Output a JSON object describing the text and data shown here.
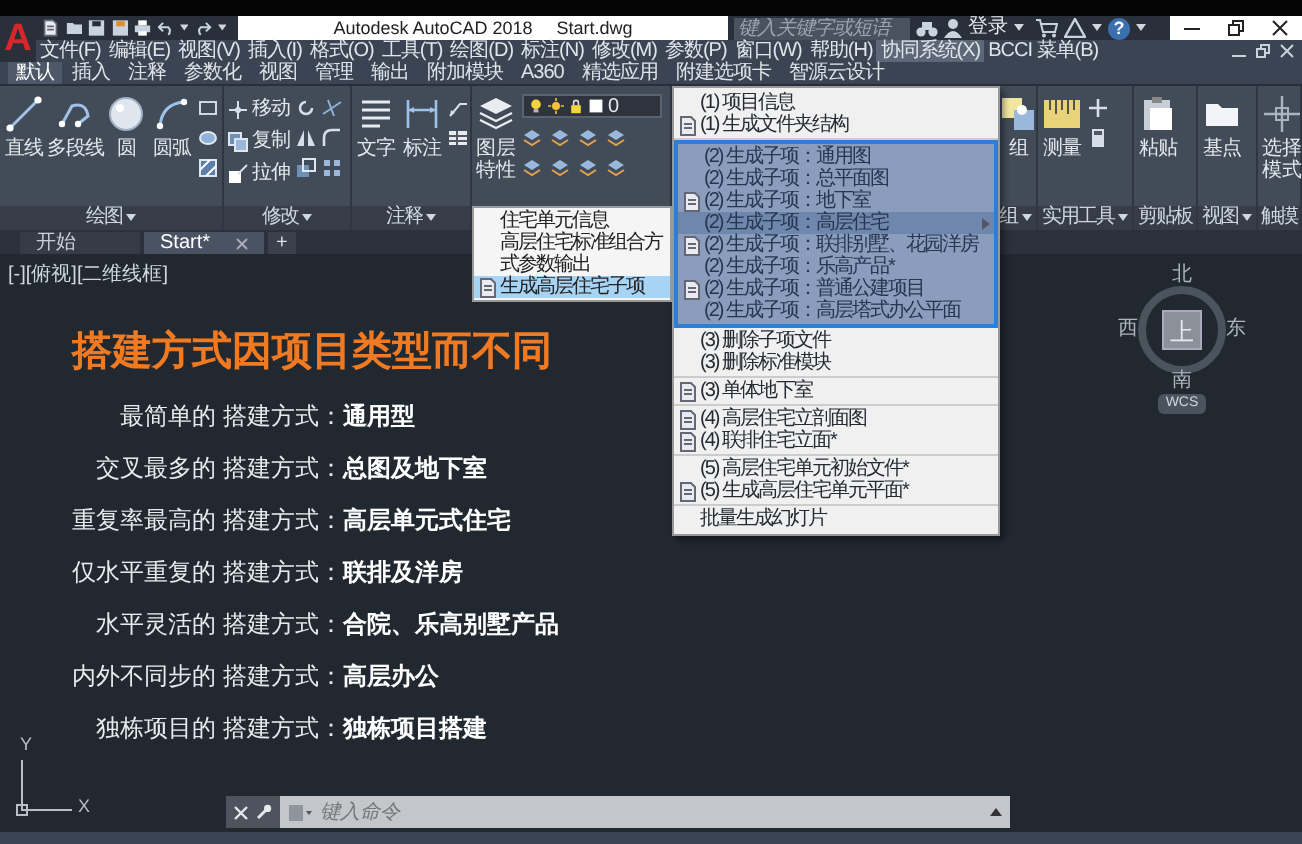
{
  "title_bar": {
    "logo": "A",
    "title": "Autodesk AutoCAD 2018",
    "file_name": "Start.dwg",
    "search": {
      "placeholder": "键入关键字或短语"
    },
    "sign_in": "登录",
    "help": "?"
  },
  "menu_bar": [
    {
      "label": "文件(F)",
      "selected": false
    },
    {
      "label": "编辑(E)",
      "selected": false
    },
    {
      "label": "视图(V)",
      "selected": false
    },
    {
      "label": "插入(I)",
      "selected": false
    },
    {
      "label": "格式(O)",
      "selected": false
    },
    {
      "label": "工具(T)",
      "selected": false
    },
    {
      "label": "绘图(D)",
      "selected": false
    },
    {
      "label": "标注(N)",
      "selected": false
    },
    {
      "label": "修改(M)",
      "selected": false
    },
    {
      "label": "参数(P)",
      "selected": false
    },
    {
      "label": "窗口(W)",
      "selected": false
    },
    {
      "label": "帮助(H)",
      "selected": false
    },
    {
      "label": "协同系统(X)",
      "selected": true
    },
    {
      "label": "BCCI 菜单(B)",
      "selected": false
    }
  ],
  "ribbon_tabs": [
    {
      "label": "默认",
      "selected": true
    },
    {
      "label": "插入",
      "selected": false
    },
    {
      "label": "注释",
      "selected": false
    },
    {
      "label": "参数化",
      "selected": false
    },
    {
      "label": "视图",
      "selected": false
    },
    {
      "label": "管理",
      "selected": false
    },
    {
      "label": "输出",
      "selected": false
    },
    {
      "label": "附加模块",
      "selected": false
    },
    {
      "label": "A360",
      "selected": false
    },
    {
      "label": "精选应用",
      "selected": false
    },
    {
      "label": "附建选项卡",
      "selected": false
    },
    {
      "label": "智源云设计",
      "selected": false
    }
  ],
  "ribbon_panels": [
    {
      "title": "绘图",
      "has_menu": true,
      "tools": [
        {
          "label": "直线",
          "kind": "large"
        },
        {
          "label": "多段线",
          "kind": "large"
        },
        {
          "label": "圆",
          "kind": "large"
        },
        {
          "label": "圆弧",
          "kind": "large"
        }
      ]
    },
    {
      "title": "修改",
      "has_menu": true,
      "tools": [
        {
          "label": "移动",
          "kind": "small"
        },
        {
          "label": "复制",
          "kind": "small"
        },
        {
          "label": "拉伸",
          "kind": "small"
        }
      ]
    },
    {
      "title": "注释",
      "has_menu": true,
      "tools": [
        {
          "label": "文字",
          "kind": "large"
        },
        {
          "label": "标注",
          "kind": "large"
        }
      ]
    },
    {
      "tools": [
        {
          "label": "图层特性",
          "kind": "large_wrapped"
        }
      ],
      "layer": "0"
    }
  ],
  "ribbon_panels_right": [
    {
      "title": "组",
      "has_menu": true,
      "tools": [
        {
          "label": "组",
          "kind": "large"
        }
      ]
    },
    {
      "title": "实用工具",
      "has_menu": true,
      "tools": [
        {
          "label": "测量",
          "kind": "large"
        }
      ]
    },
    {
      "title": "剪贴板",
      "has_menu": false,
      "tools": [
        {
          "label": "粘贴",
          "kind": "large"
        }
      ]
    },
    {
      "title": "视图",
      "has_menu": true,
      "tools": [
        {
          "label": "基点",
          "kind": "large"
        }
      ]
    },
    {
      "title": "触摸",
      "has_menu": false,
      "tools": [
        {
          "label": "选择模式",
          "kind": "large_wrapped"
        }
      ]
    }
  ],
  "file_tabs": [
    {
      "label": "开始",
      "selected": false
    },
    {
      "label": "Start*",
      "selected": true
    }
  ],
  "new_tab": "+",
  "viewport_label": "[-][俯视][二维线框]",
  "content": {
    "title": "搭建方式因项目类型而不同",
    "lines": [
      {
        "label": "最简单的 搭建方式：",
        "value": "通用型"
      },
      {
        "label": "交叉最多的 搭建方式：",
        "value": "总图及地下室"
      },
      {
        "label": "重复率最高的 搭建方式：",
        "value": "高层单元式住宅"
      },
      {
        "label": "仅水平重复的 搭建方式：",
        "value": "联排及洋房"
      },
      {
        "label": "水平灵活的 搭建方式：",
        "value": "合院、乐高别墅产品"
      },
      {
        "label": "内外不同步的 搭建方式：",
        "value": "高层办公"
      },
      {
        "label": "独栋项目的 搭建方式：",
        "value": "独栋项目搭建"
      }
    ]
  },
  "dropdown": {
    "sections": [
      {
        "framed": false,
        "items": [
          {
            "label": "(1) 项目信息",
            "has_icon": false,
            "has_submenu": false,
            "selected": false
          },
          {
            "label": "(1) 生成文件夹结构",
            "has_icon": true,
            "has_submenu": false,
            "selected": false
          }
        ]
      },
      {
        "framed": true,
        "items": [
          {
            "label": "(2) 生成子项：通用图",
            "has_icon": false,
            "has_submenu": false,
            "selected": false
          },
          {
            "label": "(2) 生成子项：总平面图",
            "has_icon": false,
            "has_submenu": false,
            "selected": false
          },
          {
            "label": "(2) 生成子项：地下室",
            "has_icon": true,
            "has_submenu": false,
            "selected": false
          },
          {
            "label": "(2) 生成子项：高层住宅",
            "has_icon": false,
            "has_submenu": true,
            "selected": true
          },
          {
            "label": "(2) 生成子项：联排别墅、花园洋房",
            "has_icon": true,
            "has_submenu": false,
            "selected": false
          },
          {
            "label": "(2) 生成子项：乐高产品*",
            "has_icon": false,
            "has_submenu": false,
            "selected": false
          },
          {
            "label": "(2) 生成子项：普通公建项目",
            "has_icon": true,
            "has_submenu": false,
            "selected": false
          },
          {
            "label": "(2) 生成子项：高层塔式办公平面",
            "has_icon": false,
            "has_submenu": false,
            "selected": false
          }
        ]
      },
      {
        "framed": false,
        "items": [
          {
            "label": "(3) 删除子项文件",
            "has_icon": false,
            "has_submenu": false,
            "selected": false
          },
          {
            "label": "(3) 删除标准模块",
            "has_icon": false,
            "has_submenu": false,
            "selected": false
          }
        ]
      },
      {
        "framed": false,
        "items": [
          {
            "label": "(3) 单体地下室",
            "has_icon": true,
            "has_submenu": false,
            "selected": false
          }
        ]
      },
      {
        "framed": false,
        "items": [
          {
            "label": "(4) 高层住宅立剖面图",
            "has_icon": true,
            "has_submenu": false,
            "selected": false
          },
          {
            "label": "(4) 联排住宅立面*",
            "has_icon": true,
            "has_submenu": false,
            "selected": false
          }
        ]
      },
      {
        "framed": false,
        "items": [
          {
            "label": "(5) 高层住宅单元初始文件*",
            "has_icon": false,
            "has_submenu": false,
            "selected": false
          },
          {
            "label": "(5) 生成高层住宅单元平面*",
            "has_icon": true,
            "has_submenu": false,
            "selected": false
          }
        ]
      },
      {
        "framed": false,
        "items": [
          {
            "label": "批量生成幻灯片",
            "has_icon": false,
            "has_submenu": false,
            "selected": false
          }
        ]
      }
    ]
  },
  "submenu": {
    "items": [
      {
        "label": "住宅单元信息",
        "has_icon": false,
        "selected": false
      },
      {
        "label": "高层住宅标准组合方式参数输出",
        "has_icon": false,
        "selected": false
      },
      {
        "label": "生成高层住宅子项",
        "has_icon": true,
        "selected": true
      }
    ]
  },
  "view_cube": {
    "north": "北",
    "west": "西",
    "top": "上",
    "east": "东",
    "south": "南",
    "ucs": "WCS"
  },
  "ucs_icon": {
    "y": "Y",
    "x": "X"
  },
  "command_line": {
    "placeholder": "键入命令"
  }
}
